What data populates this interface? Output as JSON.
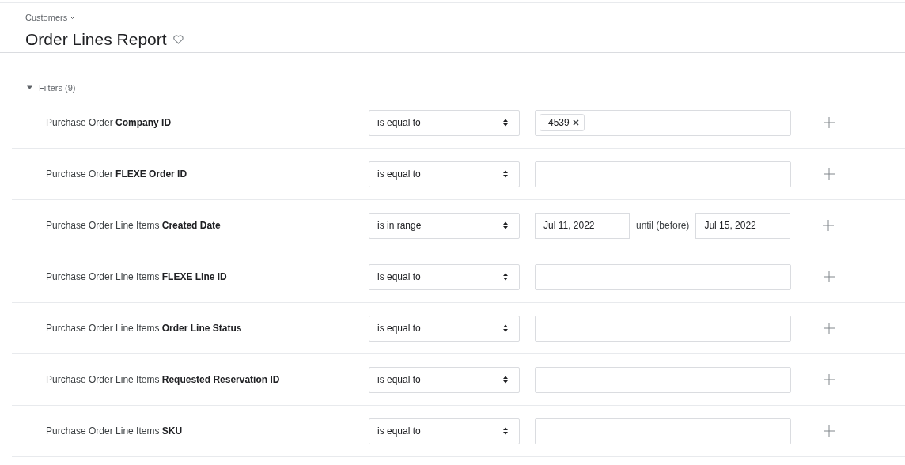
{
  "breadcrumb": "Customers",
  "title": "Order Lines Report",
  "filters": {
    "label": "Filters (9)",
    "expanded": true,
    "rows": [
      {
        "label": "Purchase Order **Company ID**",
        "operator": "is equal to",
        "kind": "tags",
        "tags": [
          "4539"
        ]
      },
      {
        "label": "Purchase Order **FLEXE Order ID**",
        "operator": "is equal to",
        "kind": "text"
      },
      {
        "label": "Purchase Order Line Items **Created Date**",
        "operator": "is in range",
        "kind": "range",
        "from": "Jul 11, 2022",
        "joiner": "until (before)",
        "to": "Jul 15, 2022"
      },
      {
        "label": "Purchase Order Line Items **FLEXE Line ID**",
        "operator": "is equal to",
        "kind": "text"
      },
      {
        "label": "Purchase Order Line Items **Order Line Status**",
        "operator": "is equal to",
        "kind": "text"
      },
      {
        "label": "Purchase Order Line Items **Requested Reservation ID**",
        "operator": "is equal to",
        "kind": "text"
      },
      {
        "label": "Purchase Order Line Items **SKU**",
        "operator": "is equal to",
        "kind": "text"
      }
    ]
  }
}
